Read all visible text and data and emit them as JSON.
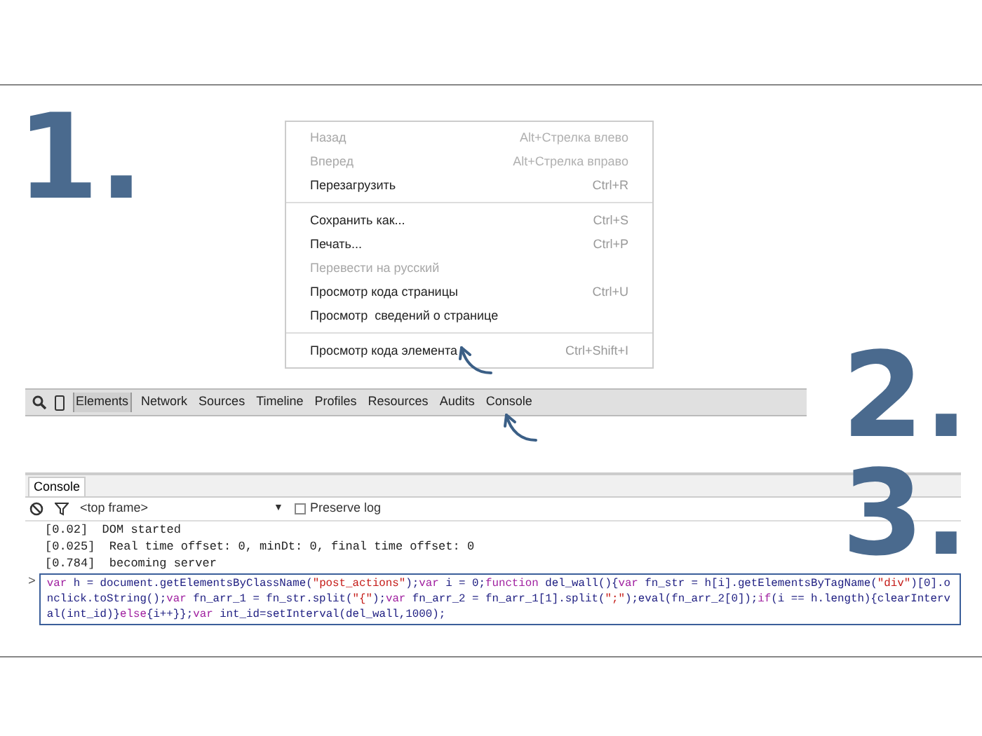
{
  "step_numbers": [
    "1.",
    "2.",
    "3."
  ],
  "context_menu": {
    "groups": [
      [
        {
          "label": "Назад",
          "shortcut": "Alt+Стрелка влево",
          "disabled": true
        },
        {
          "label": "Вперед",
          "shortcut": "Alt+Стрелка вправо",
          "disabled": true
        },
        {
          "label": "Перезагрузить",
          "shortcut": "Ctrl+R",
          "disabled": false
        }
      ],
      [
        {
          "label": "Сохранить как...",
          "shortcut": "Ctrl+S",
          "disabled": false
        },
        {
          "label": "Печать...",
          "shortcut": "Ctrl+P",
          "disabled": false
        },
        {
          "label": "Перевести на русский",
          "disabled": true
        },
        {
          "label": "Просмотр кода страницы",
          "shortcut": "Ctrl+U",
          "disabled": false
        },
        {
          "label": "Просмотр  сведений о странице",
          "disabled": false
        }
      ],
      [
        {
          "label": "Просмотр кода элемента",
          "shortcut": "Ctrl+Shift+I",
          "disabled": false
        }
      ]
    ]
  },
  "devtools_tabs": [
    {
      "label": "Elements",
      "selected": true
    },
    {
      "label": "Network",
      "selected": false
    },
    {
      "label": "Sources",
      "selected": false
    },
    {
      "label": "Timeline",
      "selected": false
    },
    {
      "label": "Profiles",
      "selected": false
    },
    {
      "label": "Resources",
      "selected": false
    },
    {
      "label": "Audits",
      "selected": false
    },
    {
      "label": "Console",
      "selected": false
    }
  ],
  "console": {
    "tab": "Console",
    "frame": "<top frame>",
    "dropdown_caret": "▼",
    "preserve_log": {
      "label": "Preserve log",
      "checked": false
    },
    "log": [
      "[0.02]  DOM started",
      "[0.025]  Real time offset: 0, minDt: 0, final time offset: 0",
      "[0.784]  becoming server"
    ],
    "prompt": ">",
    "input": [
      {
        "kind": "keyword",
        "text": "var"
      },
      {
        "kind": "plain",
        "text": " h = document.getElementsByClassName("
      },
      {
        "kind": "string",
        "text": "\"post_actions\""
      },
      {
        "kind": "plain",
        "text": ");"
      },
      {
        "kind": "keyword",
        "text": "var"
      },
      {
        "kind": "plain",
        "text": " i = 0;"
      },
      {
        "kind": "keyword",
        "text": "function"
      },
      {
        "kind": "plain",
        "text": " del_wall(){"
      },
      {
        "kind": "keyword",
        "text": "var"
      },
      {
        "kind": "plain",
        "text": " fn_str = h[i].getElementsByTagName("
      },
      {
        "kind": "string",
        "text": "\"div\""
      },
      {
        "kind": "plain",
        "text": ")[0].onclick.toString();"
      },
      {
        "kind": "keyword",
        "text": "var"
      },
      {
        "kind": "plain",
        "text": " fn_arr_1 = fn_str.split("
      },
      {
        "kind": "string",
        "text": "\"{\""
      },
      {
        "kind": "plain",
        "text": ");"
      },
      {
        "kind": "keyword",
        "text": "var"
      },
      {
        "kind": "plain",
        "text": " fn_arr_2 = fn_arr_1[1].split("
      },
      {
        "kind": "string",
        "text": "\";\""
      },
      {
        "kind": "plain",
        "text": ");eval(fn_arr_2[0]);"
      },
      {
        "kind": "keyword",
        "text": "if"
      },
      {
        "kind": "plain",
        "text": "(i == h.length){clearInterval(int_id)}"
      },
      {
        "kind": "keyword",
        "text": "else"
      },
      {
        "kind": "plain",
        "text": "{i++}};"
      },
      {
        "kind": "keyword",
        "text": "var"
      },
      {
        "kind": "plain",
        "text": " int_id=setInterval(del_wall,1000);"
      }
    ]
  }
}
